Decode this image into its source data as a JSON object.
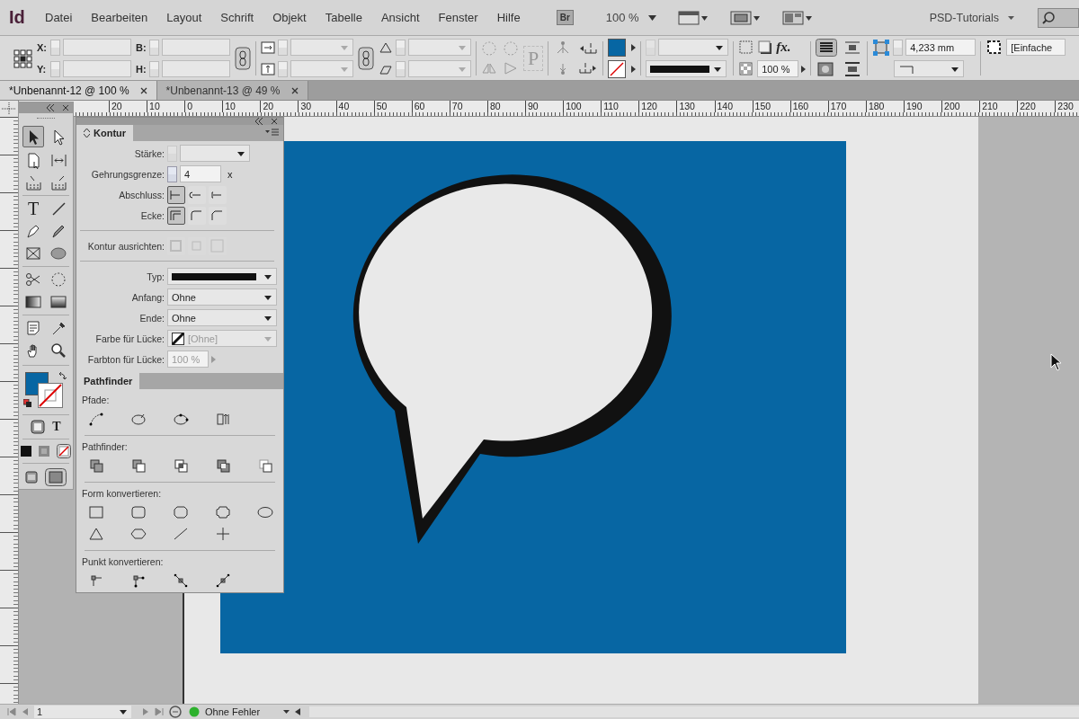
{
  "app": {
    "logo": "Id",
    "menu": [
      "Datei",
      "Bearbeiten",
      "Layout",
      "Schrift",
      "Objekt",
      "Tabelle",
      "Ansicht",
      "Fenster",
      "Hilfe"
    ],
    "bridge": "Br",
    "zoom": "100 %",
    "workspace": "PSD-Tutorials"
  },
  "control_bar": {
    "x_label": "X:",
    "y_label": "Y:",
    "w_label": "B:",
    "h_label": "H:",
    "frame_glyph": "P",
    "effects_glyph": "fx.",
    "opacity": "100 %",
    "stroke_offset": "4,233 mm",
    "object_style": "[Einfache"
  },
  "tabs": [
    {
      "label": "*Unbenannt-12 @ 100 %",
      "selected": true
    },
    {
      "label": "*Unbenannt-13 @ 49 %",
      "selected": false
    }
  ],
  "ruler": [
    "20",
    "10",
    "0",
    "10",
    "20",
    "30",
    "40",
    "50",
    "60",
    "70",
    "80",
    "90",
    "100",
    "110",
    "120",
    "130",
    "140",
    "150",
    "160",
    "170",
    "180",
    "190",
    "200",
    "210",
    "220",
    "230"
  ],
  "tools": {
    "type_glyph": "T",
    "format_glyph": "T"
  },
  "kontur": {
    "title": "Kontur",
    "rows": [
      {
        "kind": "spin-dropdown",
        "label": "Stärke:",
        "disabled": true
      },
      {
        "kind": "spin-field",
        "label": "Gehrungsgrenze:",
        "value": "4",
        "unit": "x"
      },
      {
        "kind": "buttons",
        "label": "Abschluss:",
        "disabled": false,
        "buttons": [
          {
            "selected": true
          },
          {
            "selected": false
          },
          {
            "selected": false
          }
        ]
      },
      {
        "kind": "buttons",
        "label": "Ecke:",
        "disabled": false,
        "buttons": [
          {
            "selected": true
          },
          {
            "selected": false
          },
          {
            "selected": false
          }
        ]
      },
      {
        "kind": "divider"
      },
      {
        "kind": "buttons",
        "label": "Kontur ausrichten:",
        "disabled": true,
        "buttons": [
          {
            "selected": false
          },
          {
            "selected": false
          },
          {
            "selected": false
          }
        ]
      },
      {
        "kind": "divider"
      },
      {
        "kind": "line-dropdown",
        "label": "Typ:"
      },
      {
        "kind": "dropdown",
        "label": "Anfang:",
        "value": "Ohne",
        "disabled": false
      },
      {
        "kind": "dropdown",
        "label": "Ende:",
        "value": "Ohne",
        "disabled": false
      },
      {
        "kind": "swatch-dropdown",
        "label": "Farbe für Lücke:",
        "value": "[Ohne]",
        "disabled": true
      },
      {
        "kind": "percent",
        "label": "Farbton für Lücke:",
        "value": "100 %",
        "disabled": true
      }
    ]
  },
  "pathfinder": {
    "title": "Pathfinder",
    "sections": [
      "Pfade:",
      "Pathfinder:",
      "Form konvertieren:",
      "Punkt konvertieren:"
    ]
  },
  "status_bar": {
    "page": "1",
    "preflight": "Ohne Fehler"
  }
}
